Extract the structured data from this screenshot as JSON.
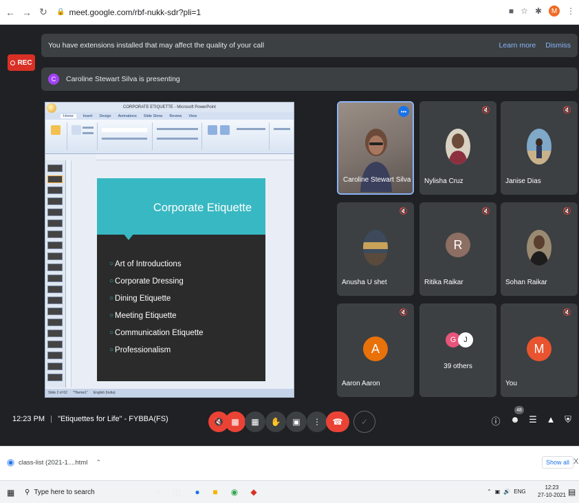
{
  "browser": {
    "url": "meet.google.com/rbf-nukk-sdr?pli=1",
    "profile_initial": "M"
  },
  "meet": {
    "rec_label": "REC",
    "extension_banner": {
      "text": "You have extensions installed that may affect the quality of your call",
      "learn_more": "Learn more",
      "dismiss": "Dismiss"
    },
    "presenting_banner": {
      "avatar_letter": "C",
      "text": "Caroline Stewart Silva is presenting"
    },
    "presentation": {
      "window_title": "CORPORATE ETIQUETTE - Microsoft PowerPoint",
      "ribbon_tabs": [
        "Home",
        "Insert",
        "Design",
        "Animations",
        "Slide Show",
        "Review",
        "View"
      ],
      "slide_title": "Corporate  Etiquette",
      "bullets": [
        "Art of Introductions",
        "Corporate Dressing",
        "Dining Etiquette",
        "Meeting Etiquette",
        "Communication Etiquette",
        "Professionalism"
      ],
      "status": {
        "slide": "Slide 2 of 62",
        "theme": "\"Theme1\"",
        "language": "English (India)"
      }
    },
    "participants": [
      {
        "name": "Caroline Stewart Silva",
        "kind": "video"
      },
      {
        "name": "Nylisha Cruz",
        "kind": "photo",
        "muted": true
      },
      {
        "name": "Janise Dias",
        "kind": "photo",
        "muted": true
      },
      {
        "name": "Anusha U shet",
        "kind": "photo",
        "muted": true
      },
      {
        "name": "Ritika Raikar",
        "kind": "letter",
        "letter": "R",
        "color": "#8d6e63",
        "muted": true
      },
      {
        "name": "Sohan Raikar",
        "kind": "photo",
        "muted": true
      },
      {
        "name": "Aaron Aaron",
        "kind": "letter",
        "letter": "A",
        "color": "#e8710a",
        "muted": true
      },
      {
        "name": "39 others",
        "kind": "others",
        "letters": [
          "G",
          "J"
        ]
      },
      {
        "name": "You",
        "kind": "letter",
        "letter": "M",
        "color": "#e8542f",
        "muted": true
      }
    ],
    "bottombar": {
      "time": "12:23 PM",
      "separator": "|",
      "meeting_title": "\"Etiquettes for Life\" - FYBBA(FS)",
      "people_count": "48"
    }
  },
  "downloads": {
    "file": "class-list (2021-1....html",
    "show_all": "Show all",
    "close": "X"
  },
  "taskbar": {
    "search_placeholder": "Type here to search",
    "language": "ENG",
    "time": "12:23",
    "date": "27-10-2021"
  },
  "colors": {
    "meet_bg": "#202124",
    "tile_bg": "#3c4043",
    "danger": "#ea4335",
    "accent": "#8ab4f8",
    "slide_header": "#38b8c2"
  }
}
